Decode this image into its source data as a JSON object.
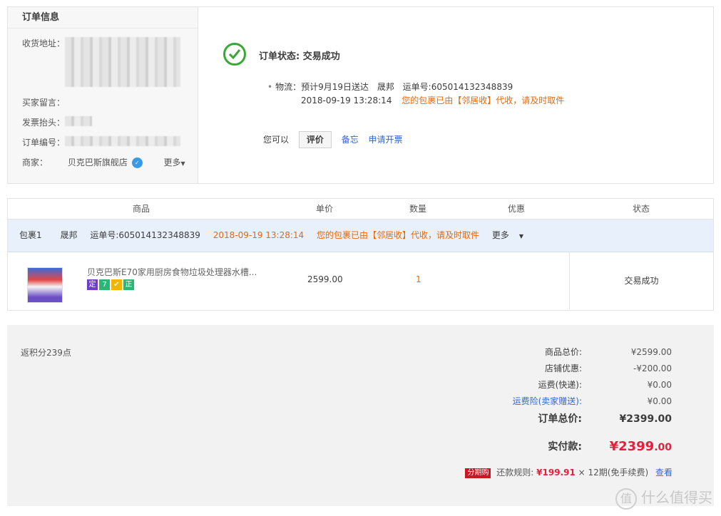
{
  "order_info": {
    "heading": "订单信息",
    "address_label": "收货地址：",
    "message_label": "买家留言：",
    "invoice_label": "发票抬头：",
    "order_no_label": "订单编号：",
    "seller_label": "商家：",
    "seller_name": "贝克巴斯旗舰店",
    "more_label": "更多"
  },
  "status": {
    "title": "订单状态: 交易成功",
    "logistics_prefix": "物流：预计9月19日送达",
    "carrier": "晟邦",
    "tracking": "运单号:605014132348839",
    "time": "2018-09-19 13:28:14",
    "message": "您的包裹已由【邻居收】代收，请及时取件",
    "actions_lead": "您可以",
    "rate_button": "评价",
    "memo_link": "备忘",
    "invoice_link": "申请开票"
  },
  "table": {
    "headers": [
      "商品",
      "单价",
      "数量",
      "优惠",
      "状态"
    ],
    "package": {
      "label": "包裹1",
      "carrier": "晟邦",
      "tracking": "运单号:605014132348839",
      "time": "2018-09-19 13:28:14",
      "message": "您的包裹已由【邻居收】代收，请及时取件",
      "more": "更多"
    },
    "item": {
      "title": "贝克巴斯E70家用厨房食物垃圾处理器水槽...",
      "tags": [
        "定",
        "7",
        "",
        "正"
      ],
      "tag_colors": [
        "#6d3fc4",
        "#2bb673",
        "#f4b400",
        "#2bb673"
      ],
      "price": "2599.00",
      "qty": "1",
      "status": "交易成功"
    }
  },
  "summary": {
    "points": "返积分239点",
    "goods_total_label": "商品总价:",
    "goods_total": "¥2599.00",
    "shop_discount_label": "店铺优惠:",
    "shop_discount": "-¥200.00",
    "shipping_label": "运费(快递):",
    "shipping": "¥0.00",
    "shipping_ins_label": "运费险(卖家赠送):",
    "shipping_ins": "¥0.00",
    "order_total_label": "订单总价:",
    "order_total": "¥2399.00",
    "paid_label": "实付款:",
    "paid_main": "¥2399",
    "paid_cents": ".00",
    "installment_tag": "分期购",
    "installment_prefix": "还款规则:",
    "installment_amount": "¥199.91",
    "installment_suffix": "× 12期(免手续费)",
    "installment_link": "查看"
  },
  "watermark": {
    "text": "什么值得买",
    "mark": "值"
  }
}
